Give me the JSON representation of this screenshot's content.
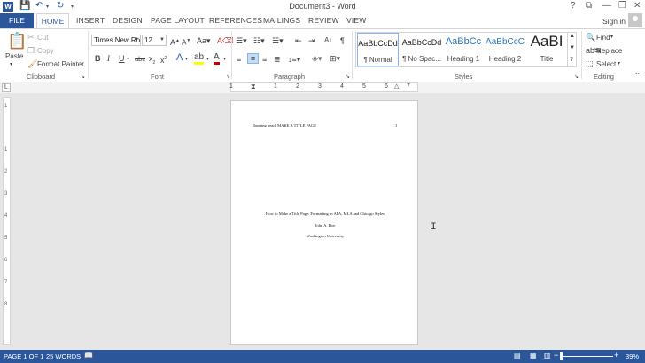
{
  "titlebar": {
    "app_icon": "W",
    "title": "Document3 - Word",
    "help": "?",
    "restore_ribbon": "⧉",
    "minimize": "—",
    "maximize": "❐",
    "close": "✕"
  },
  "tabs": {
    "file": "FILE",
    "home": "HOME",
    "insert": "INSERT",
    "design": "DESIGN",
    "page_layout": "PAGE LAYOUT",
    "references": "REFERENCES",
    "mailings": "MAILINGS",
    "review": "REVIEW",
    "view": "VIEW",
    "sign_in": "Sign in"
  },
  "clipboard": {
    "paste": "Paste",
    "cut": "Cut",
    "copy": "Copy",
    "format_painter": "Format Painter",
    "label": "Clipboard"
  },
  "font": {
    "family": "Times New Ro",
    "size": "12",
    "label": "Font"
  },
  "paragraph": {
    "label": "Paragraph"
  },
  "styles": {
    "label": "Styles",
    "items": [
      {
        "preview": "AaBbCcDd",
        "name": "¶ Normal"
      },
      {
        "preview": "AaBbCcDd",
        "name": "¶ No Spac..."
      },
      {
        "preview": "AaBbCc",
        "name": "Heading 1"
      },
      {
        "preview": "AaBbCcC",
        "name": "Heading 2"
      },
      {
        "preview": "AaBI",
        "name": "Title"
      }
    ]
  },
  "editing": {
    "label": "Editing",
    "find": "Find",
    "replace": "Replace",
    "select": "Select"
  },
  "ruler": {
    "tab_selector": "L",
    "numbers": [
      "1",
      "1",
      "2",
      "3",
      "4",
      "5",
      "6",
      "7"
    ],
    "vertical_numbers": [
      "1",
      "1",
      "2",
      "3",
      "4",
      "5",
      "6",
      "7",
      "8"
    ]
  },
  "document": {
    "header_left": "Running head: MAKE A TITLE PAGE",
    "header_page": "1",
    "title": "How to Make a Title Page: Formatting in APA, MLA and Chicago Styles",
    "author": "John A. Doe",
    "institution": "Washington University"
  },
  "status": {
    "page": "PAGE 1 OF 1",
    "words": "25 WORDS",
    "zoom": "39%",
    "minus": "−",
    "plus": "+"
  },
  "colors": {
    "accent": "#2b579a",
    "highlight": "#ffff00",
    "font_color": "#c00000"
  }
}
